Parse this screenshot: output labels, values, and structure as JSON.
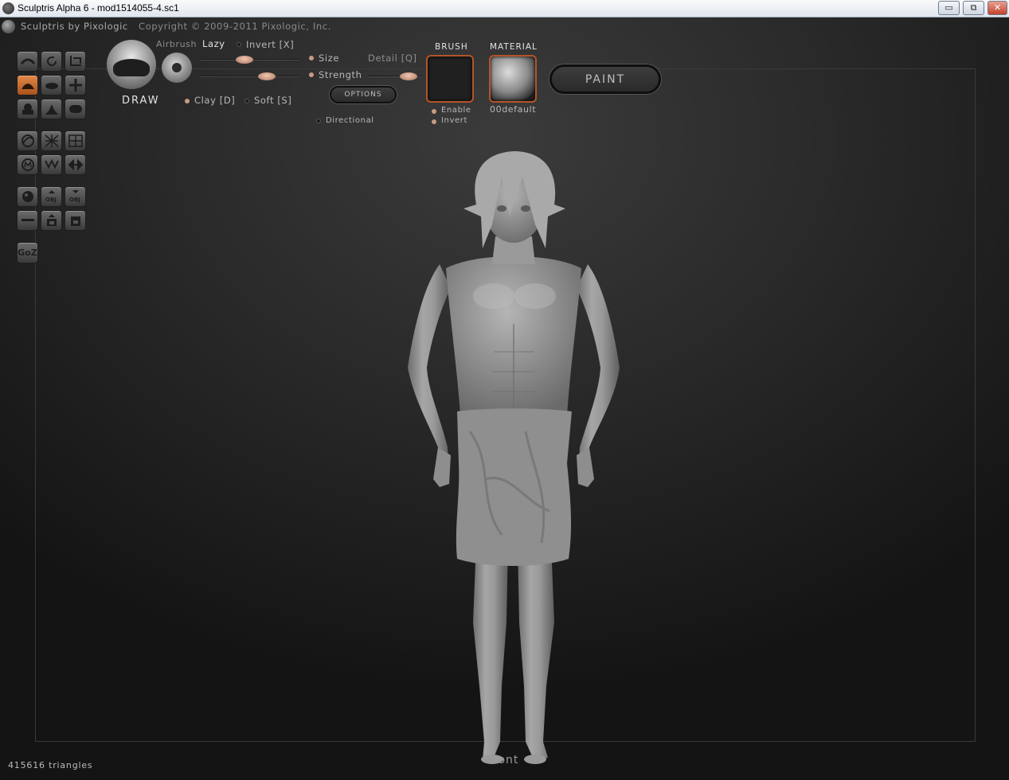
{
  "window": {
    "title": "Sculptris Alpha 6 - mod1514055-4.sc1",
    "minimize_glyph": "▭",
    "maximize_glyph": "⧉",
    "close_glyph": "✕"
  },
  "header": {
    "brand": "Sculptris by Pixologic",
    "copyright": "Copyright © 2009-2011 Pixologic, Inc."
  },
  "tools": [
    {
      "icon": "crease-icon"
    },
    {
      "icon": "rotate-icon"
    },
    {
      "icon": "scale-icon"
    },
    {
      "icon": "draw-icon",
      "active": true
    },
    {
      "icon": "flatten-icon"
    },
    {
      "icon": "grab-icon"
    },
    {
      "icon": "inflate-icon"
    },
    {
      "icon": "pinch-icon"
    },
    {
      "icon": "smooth-icon"
    },
    {
      "icon": "symmetry-icon"
    },
    {
      "icon": "wireframe-icon"
    },
    {
      "icon": "grid-icon"
    },
    {
      "icon": "mask-icon"
    },
    {
      "icon": "reduce-icon"
    },
    {
      "icon": "mirror-icon"
    },
    {
      "icon": "new-sphere-icon"
    },
    {
      "icon": "import-obj-icon"
    },
    {
      "icon": "export-obj-icon"
    },
    {
      "icon": "open-icon"
    },
    {
      "icon": "save-icon"
    },
    {
      "icon": "save-as-icon"
    }
  ],
  "goz_label": "GoZ",
  "brush_panel": {
    "tool_name": "DRAW",
    "airbrush": "Airbrush",
    "lazy": "Lazy",
    "invert": "Invert [X]",
    "size": "Size",
    "detail": "Detail [Q]",
    "strength": "Strength",
    "options": "OPTIONS",
    "clay": "Clay [D]",
    "soft": "Soft [S]",
    "directional": "Directional",
    "size_slider": 0.45,
    "strength_slider": 0.68,
    "detail_slider": 0.75
  },
  "brush_section": {
    "title": "BRUSH",
    "enable": "Enable",
    "invert": "Invert"
  },
  "material_section": {
    "title": "MATERIAL",
    "name": "00default"
  },
  "paint_button": "PAINT",
  "status": {
    "triangles": "415616 triangles",
    "view": "Front"
  },
  "colors": {
    "accent": "#c8642c",
    "mesh": "#8c8c8c"
  }
}
